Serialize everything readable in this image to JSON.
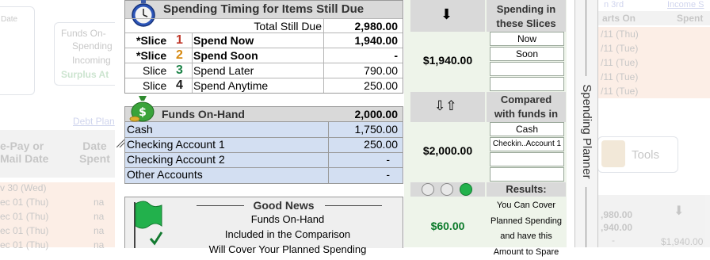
{
  "background_left": {
    "date_header": "Date",
    "funds_on_hand_label": "Funds On-",
    "spending_label": "Spending",
    "incoming_label": "Incoming",
    "surplus_label": "Surplus At",
    "debt_plan_link": "Debt Plan",
    "prepay_header": "e-Pay or\nMail Date",
    "date_spent_header": "Date\nSpent",
    "rows": [
      {
        "date": "v 30 (Wed)",
        "spent": ""
      },
      {
        "date": "ec 01 (Thu)",
        "spent": "na"
      },
      {
        "date": "ec 01 (Thu)",
        "spent": "na"
      },
      {
        "date": "ec 01 (Thu)",
        "spent": "na"
      },
      {
        "date": "ec 01 (Thu)",
        "spent": "na"
      }
    ]
  },
  "timing": {
    "title": "Spending Timing for Items Still Due",
    "total_label": "Total Still Due",
    "total_value": "2,980.00",
    "slices": [
      {
        "prefix": "*Slice",
        "num": "1",
        "label": "Spend Now",
        "value": "1,940.00",
        "color": "#c0392b",
        "bold": true
      },
      {
        "prefix": "*Slice",
        "num": "2",
        "label": "Spend Soon",
        "value": "-",
        "color": "#d68910",
        "bold": true
      },
      {
        "prefix": "Slice",
        "num": "3",
        "label": "Spend Later",
        "value": "790.00",
        "color": "#1e8449",
        "bold": false
      },
      {
        "prefix": "Slice",
        "num": "4",
        "label": "Spend Anytime",
        "value": "250.00",
        "color": "#1a1a1a",
        "bold": false
      }
    ]
  },
  "funds": {
    "title": "Funds On-Hand",
    "total_value": "2,000.00",
    "accounts": [
      {
        "label": "Cash",
        "value": "1,750.00"
      },
      {
        "label": "Checking Account 1",
        "value": "250.00"
      },
      {
        "label": "Checking Account 2",
        "value": "-"
      },
      {
        "label": "Other Accounts",
        "value": "-"
      }
    ]
  },
  "good_news": {
    "title": "Good News",
    "line1": "Funds On-Hand",
    "line2": "Included in the Comparison",
    "line3": "Will Cover Your Planned Spending"
  },
  "middle": {
    "spending_header": "Spending in\nthese Slices",
    "slice_boxes": [
      "Now",
      "Soon"
    ],
    "spending_total": "$1,940.00",
    "compared_header": "Compared\nwith funds in",
    "fund_boxes": [
      "Cash",
      "Checkin..Account 1"
    ],
    "funds_total": "$2,000.00",
    "results_label": "Results:",
    "results_text": "You Can Cover\nPlanned Spending\nand have this\nAmount to Spare",
    "surplus": "$60.00",
    "colors": {
      "surplus": "#0b7a2a",
      "light_green": "#22b14c"
    }
  },
  "sidebar": {
    "label": "Spending Planner"
  },
  "background_right": {
    "link1": "n 3rd",
    "link2": "Income S",
    "col1_header": "arts On",
    "col2_header": "Spent",
    "dates": [
      "/11 (Thu)",
      "/11 (Tue)",
      "/11 (Tue)",
      "/11 (Tue)",
      "/11 (Tue)"
    ],
    "tools_label": "Tools",
    "values": [
      ",980.00",
      ",940.00",
      "-"
    ],
    "amount": "$1,940.00"
  }
}
